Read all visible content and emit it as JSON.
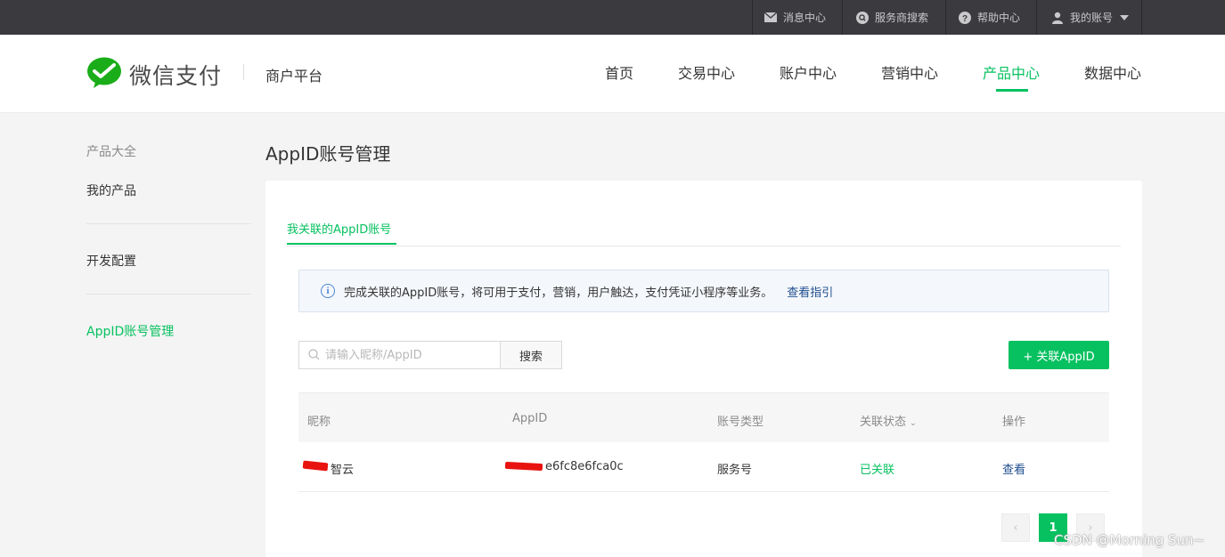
{
  "topbar": {
    "messages": "消息中心",
    "service_search": "服务商搜索",
    "help": "帮助中心",
    "account": "我的账号"
  },
  "header": {
    "logo_text": "微信支付",
    "platform": "商户平台",
    "nav": [
      "首页",
      "交易中心",
      "账户中心",
      "营销中心",
      "产品中心",
      "数据中心"
    ],
    "active_nav": "产品中心"
  },
  "sidebar": {
    "category": "产品大全",
    "items": [
      "我的产品",
      "开发配置",
      "AppID账号管理"
    ],
    "active_item": "AppID账号管理"
  },
  "main": {
    "title": "AppID账号管理",
    "tab": "我关联的AppID账号",
    "notice": {
      "text": "完成关联的AppID账号，将可用于支付，营销，用户触达，支付凭证小程序等业务。",
      "link": "查看指引"
    },
    "search": {
      "placeholder": "请输入昵称/AppID",
      "button": "搜索"
    },
    "add_button": "+ 关联AppID",
    "table": {
      "columns": [
        "昵称",
        "AppID",
        "账号类型",
        "关联状态",
        "操作"
      ],
      "rows": [
        {
          "nickname": "智云",
          "appid": "e6fc8e6fca0c",
          "type": "服务号",
          "status": "已关联",
          "action": "查看"
        }
      ]
    },
    "pagination": {
      "current_page": "1",
      "prev": "‹",
      "next": "›"
    }
  },
  "watermark": "CSDN @Morning Sun~",
  "colors": {
    "brand_green": "#07c160",
    "topbar": "#3b3b3f",
    "link_blue": "#1f4d8f"
  }
}
